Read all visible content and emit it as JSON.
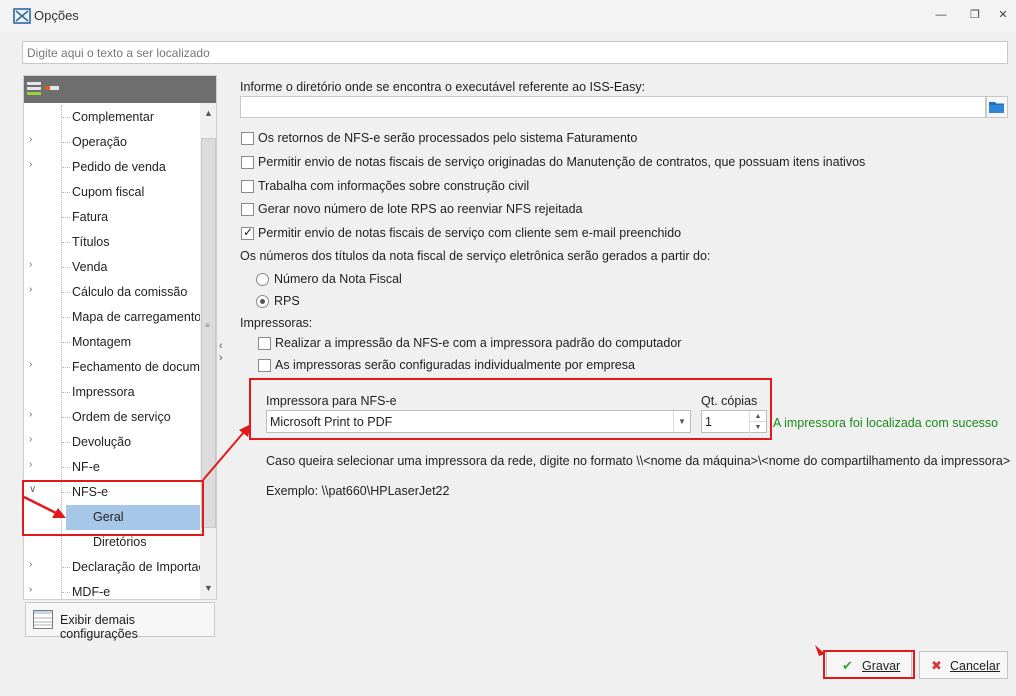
{
  "window": {
    "title": "Opções"
  },
  "search": {
    "placeholder": "Digite aqui o texto a ser localizado"
  },
  "tree": {
    "items": [
      {
        "label": "Complementar",
        "expandable": false
      },
      {
        "label": "Operação",
        "expandable": true
      },
      {
        "label": "Pedido de venda",
        "expandable": true
      },
      {
        "label": "Cupom fiscal",
        "expandable": false
      },
      {
        "label": "Fatura",
        "expandable": false
      },
      {
        "label": "Títulos",
        "expandable": false
      },
      {
        "label": "Venda",
        "expandable": true
      },
      {
        "label": "Cálculo da comissão",
        "expandable": true
      },
      {
        "label": "Mapa de carregamento",
        "expandable": false
      },
      {
        "label": "Montagem",
        "expandable": false
      },
      {
        "label": "Fechamento de documentos",
        "expandable": true
      },
      {
        "label": "Impressora",
        "expandable": false
      },
      {
        "label": "Ordem de serviço",
        "expandable": true
      },
      {
        "label": "Devolução",
        "expandable": true
      },
      {
        "label": "NF-e",
        "expandable": true
      },
      {
        "label": "NFS-e",
        "expandable": true,
        "expanded": true
      },
      {
        "label": "Geral",
        "child": true,
        "selected": true
      },
      {
        "label": "Diretórios",
        "child": true
      },
      {
        "label": "Declaração de Importação",
        "expandable": true
      },
      {
        "label": "MDF-e",
        "expandable": true
      }
    ]
  },
  "more_button": {
    "label": "Exibir demais configurações"
  },
  "settings": {
    "dir_label": "Informe o diretório onde se encontra o executável referente ao ISS-Easy:",
    "dir_value": "",
    "checkboxes": [
      {
        "label": "Os retornos de NFS-e serão processados pelo sistema Faturamento",
        "checked": false
      },
      {
        "label": "Permitir envio de notas fiscais de serviço originadas do Manutenção de contratos, que possuam itens inativos",
        "checked": false
      },
      {
        "label": "Trabalha com informações sobre construção civil",
        "checked": false
      },
      {
        "label": "Gerar novo número de lote RPS ao reenviar NFS rejeitada",
        "checked": false
      },
      {
        "label": "Permitir envio de notas fiscais de serviço com cliente sem e-mail preenchido",
        "checked": true
      }
    ],
    "numbering_label": "Os números dos títulos da nota fiscal de serviço eletrônica serão gerados a partir do:",
    "radios": [
      {
        "label": "Número da Nota Fiscal",
        "checked": false
      },
      {
        "label": "RPS",
        "checked": true
      }
    ],
    "printers_label": "Impressoras:",
    "printer_checkboxes": [
      {
        "label": "Realizar a impressão da NFS-e com a impressora padrão do computador",
        "checked": false
      },
      {
        "label": "As impressoras serão configuradas individualmente por empresa",
        "checked": false
      }
    ],
    "printer_field_label": "Impressora para NFS-e",
    "printer_value": "Microsoft Print to PDF",
    "copies_label": "Qt. cópias",
    "copies_value": "1",
    "printer_status": "A impressora foi localizada com sucesso",
    "network_hint": "Caso queira selecionar uma impressora da rede, digite no formato \\\\<nome da máquina>\\<nome do compartilhamento da impressora>",
    "example": "Exemplo: \\\\pat660\\HPLaserJet22"
  },
  "buttons": {
    "save": "Gravar",
    "cancel": "Cancelar"
  },
  "colors": {
    "annotation_red": "#e01a1a",
    "success_green": "#1a8a1a",
    "selection_blue": "#a7c7e8"
  }
}
